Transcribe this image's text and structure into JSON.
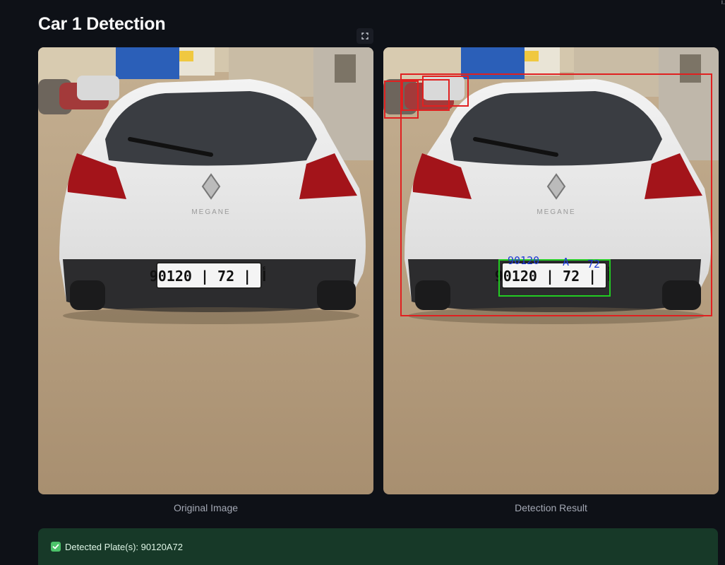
{
  "header": {
    "title": "Car 1 Detection"
  },
  "images": {
    "original": {
      "caption": "Original Image",
      "plate_text": "90120 | أ | 72",
      "badge_text": "MEGANE"
    },
    "result": {
      "caption": "Detection Result",
      "plate_text": "90120 | أ | 72",
      "badge_text": "MEGANE",
      "ocr_left": "90120",
      "ocr_mid": "A",
      "ocr_right": "72"
    }
  },
  "alert": {
    "icon": "check-icon",
    "text": "Detected Plate(s): 90120A72"
  },
  "colors": {
    "background": "#0e1117",
    "alert_bg": "#173928",
    "car_box": "#e02020",
    "plate_box": "#22cc22",
    "ocr_text": "#1f3bd6"
  }
}
